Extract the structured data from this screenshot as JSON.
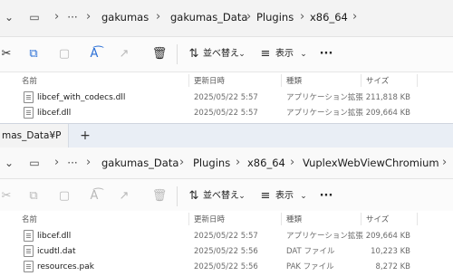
{
  "window1": {
    "breadcrumb": [
      "gakumas",
      "gakumas_Data",
      "Plugins",
      "x86_64"
    ],
    "toolbar": {
      "sort_label": "並べ替え",
      "view_label": "表示",
      "more_label": "···"
    },
    "columns": {
      "name": "名前",
      "date": "更新日時",
      "type": "種類",
      "size": "サイズ"
    },
    "files": [
      {
        "name": "libcef_with_codecs.dll",
        "date": "2025/05/22 5:57",
        "type": "アプリケーション拡張",
        "size": "211,818 KB"
      },
      {
        "name": "libcef.dll",
        "date": "2025/05/22 5:57",
        "type": "アプリケーション拡張",
        "size": "209,664 KB"
      }
    ]
  },
  "window2": {
    "tab_title": "mas_Data¥P",
    "new_tab": "+",
    "breadcrumb": [
      "gakumas_Data",
      "Plugins",
      "x86_64",
      "VuplexWebViewChromium"
    ],
    "toolbar": {
      "sort_label": "並べ替え",
      "view_label": "表示",
      "more_label": "···"
    },
    "columns": {
      "name": "名前",
      "date": "更新日時",
      "type": "種類",
      "size": "サイズ"
    },
    "files": [
      {
        "name": "libcef.dll",
        "date": "2025/05/22 5:57",
        "type": "アプリケーション拡張",
        "size": "209,664 KB"
      },
      {
        "name": "icudtl.dat",
        "date": "2025/05/22 5:56",
        "type": "DAT ファイル",
        "size": "10,223 KB"
      },
      {
        "name": "resources.pak",
        "date": "2025/05/22 5:56",
        "type": "PAK ファイル",
        "size": "8,272 KB"
      }
    ]
  }
}
